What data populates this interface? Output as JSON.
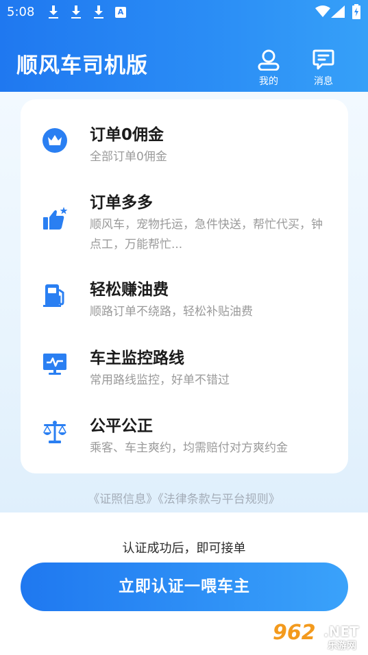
{
  "status_bar": {
    "time": "5:08",
    "notification_icon_letter": "A"
  },
  "header": {
    "title": "顺风车司机版",
    "mine_label": "我的",
    "messages_label": "消息"
  },
  "features": [
    {
      "icon": "crown-icon",
      "title": "订单0佣金",
      "desc": "全部订单0佣金"
    },
    {
      "icon": "thumbs-up-star-icon",
      "title": "订单多多",
      "desc": "顺风车，宠物托运，急件快送，帮忙代买，钟点工，万能帮忙..."
    },
    {
      "icon": "gas-pump-icon",
      "title": "轻松赚油费",
      "desc": "顺路订单不绕路，轻松补贴油费"
    },
    {
      "icon": "monitor-icon",
      "title": "车主监控路线",
      "desc": "常用路线监控，好单不错过"
    },
    {
      "icon": "balance-scale-icon",
      "title": "公平公正",
      "desc": "乘客、车主爽约，均需赔付对方爽约金"
    }
  ],
  "links": {
    "license": "《证照信息》",
    "legal": "《法律条款与平台规则》"
  },
  "notice": "认证成功后，即可接单",
  "cta_label": "立即认证一喂车主",
  "watermark": {
    "number": "962",
    "net": ".NET",
    "site": "乐游网"
  },
  "colors": {
    "primary": "#1f78f0",
    "primary_light": "#3aa2fa",
    "icon_blue": "#2a7ff2"
  }
}
